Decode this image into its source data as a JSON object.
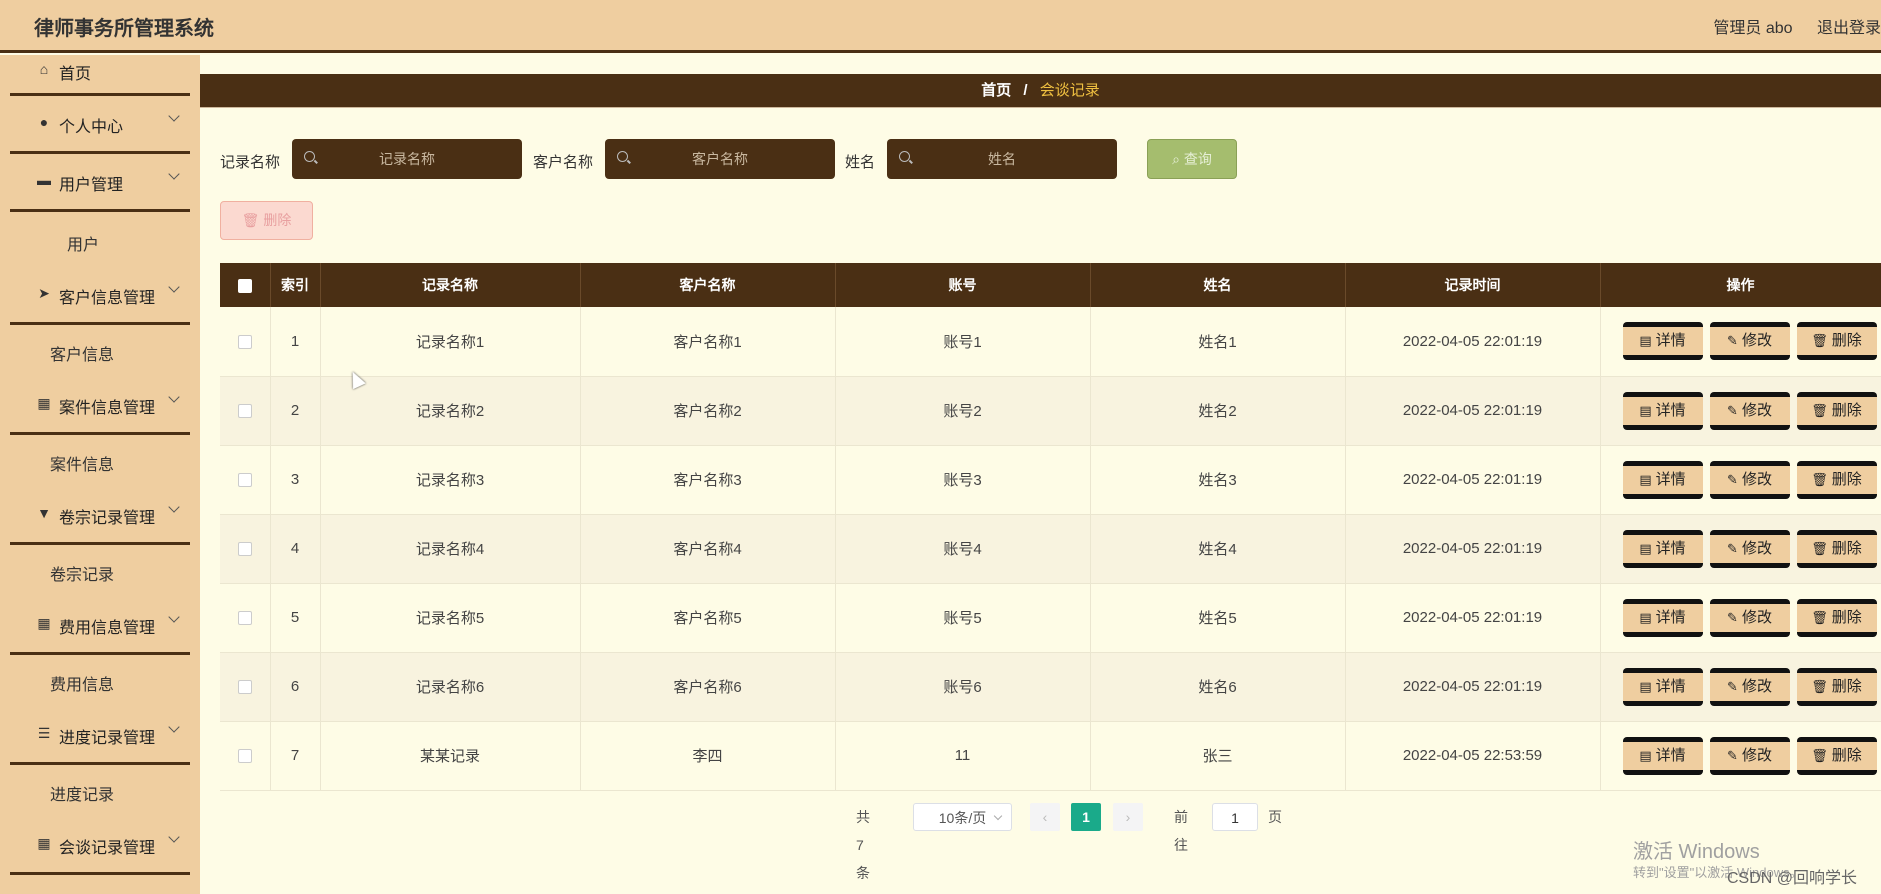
{
  "header": {
    "title": "律师事务所管理系统",
    "user_label": "管理员 abo",
    "logout_label": "退出登录"
  },
  "sidebar": {
    "items": [
      {
        "label": "首页",
        "icon": "home-icon"
      },
      {
        "label": "个人中心",
        "icon": "user-icon"
      },
      {
        "label": "用户管理",
        "icon": "briefcase-icon"
      },
      {
        "label": "用户"
      },
      {
        "label": "客户信息管理",
        "icon": "send-icon"
      },
      {
        "label": "客户信息"
      },
      {
        "label": "案件信息管理",
        "icon": "grid-icon"
      },
      {
        "label": "案件信息"
      },
      {
        "label": "卷宗记录管理",
        "icon": "stamp-icon"
      },
      {
        "label": "卷宗记录"
      },
      {
        "label": "费用信息管理",
        "icon": "grid-icon"
      },
      {
        "label": "费用信息"
      },
      {
        "label": "进度记录管理",
        "icon": "list-icon"
      },
      {
        "label": "进度记录"
      },
      {
        "label": "会谈记录管理",
        "icon": "grid-icon"
      }
    ]
  },
  "breadcrumb": {
    "home": "首页",
    "separator": "/",
    "current": "会谈记录"
  },
  "search": {
    "record_name_label": "记录名称",
    "record_name_placeholder": "记录名称",
    "client_name_label": "客户名称",
    "client_name_placeholder": "客户名称",
    "name_label": "姓名",
    "name_placeholder": "姓名",
    "query_label": "查询"
  },
  "toolbar": {
    "delete_label": "删除"
  },
  "table": {
    "headers": [
      "索引",
      "记录名称",
      "客户名称",
      "账号",
      "姓名",
      "记录时间",
      "操作"
    ],
    "rows": [
      [
        "1",
        "记录名称1",
        "客户名称1",
        "账号1",
        "姓名1",
        "2022-04-05 22:01:19"
      ],
      [
        "2",
        "记录名称2",
        "客户名称2",
        "账号2",
        "姓名2",
        "2022-04-05 22:01:19"
      ],
      [
        "3",
        "记录名称3",
        "客户名称3",
        "账号3",
        "姓名3",
        "2022-04-05 22:01:19"
      ],
      [
        "4",
        "记录名称4",
        "客户名称4",
        "账号4",
        "姓名4",
        "2022-04-05 22:01:19"
      ],
      [
        "5",
        "记录名称5",
        "客户名称5",
        "账号5",
        "姓名5",
        "2022-04-05 22:01:19"
      ],
      [
        "6",
        "记录名称6",
        "客户名称6",
        "账号6",
        "姓名6",
        "2022-04-05 22:01:19"
      ],
      [
        "7",
        "某某记录",
        "李四",
        "11",
        "张三",
        "2022-04-05 22:53:59"
      ]
    ],
    "actions": {
      "detail": "详情",
      "edit": "修改",
      "delete": "删除"
    }
  },
  "pagination": {
    "total_text": "共 7 条",
    "page_size": "10条/页",
    "current_page": "1",
    "goto_label": "前往",
    "goto_value": "1",
    "page_suffix": "页"
  },
  "watermark": {
    "line1": "激活 Windows",
    "line2": "转到\"设置\"以激活 Windows。",
    "csdn": "CSDN @回响学长"
  },
  "colors": {
    "header_bg": "#efcea0",
    "accent_dark": "#4a2f14",
    "page_bg": "#fefce6",
    "query_button": "#a5bd6e",
    "pagination_active": "#1aaa8a",
    "breadcrumb_current": "#f0c040"
  }
}
